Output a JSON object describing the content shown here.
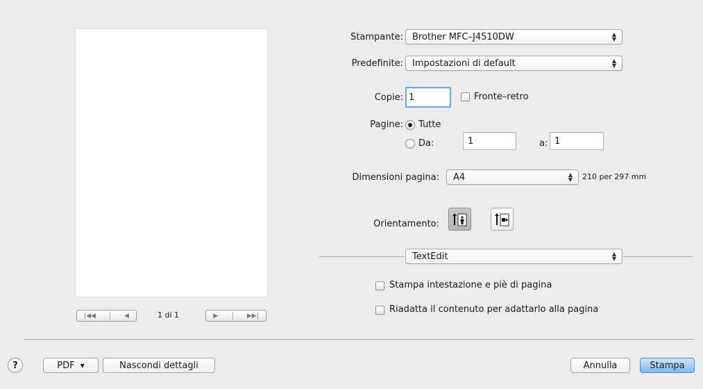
{
  "preview": {
    "page_counter": "1 di 1",
    "first_icon": "|◀◀",
    "prev_icon": "◀",
    "next_icon": "▶",
    "last_icon": "▶▶|"
  },
  "printer": {
    "label": "Stampante:",
    "value": "Brother MFC–J4510DW"
  },
  "presets": {
    "label": "Predefinite:",
    "value": "Impostazioni di default"
  },
  "copies": {
    "label": "Copie:",
    "value": "1",
    "duplex_label": "Fronte–retro",
    "duplex_checked": false
  },
  "pages": {
    "label": "Pagine:",
    "all_label": "Tutte",
    "all_selected": true,
    "range_label": "Da:",
    "from_value": "1",
    "to_label": "a:",
    "to_value": "1"
  },
  "paper_size": {
    "label": "Dimensioni pagina:",
    "value": "A4",
    "dimensions": "210 per 297 mm"
  },
  "orientation": {
    "label": "Orientamento:",
    "selected": "portrait"
  },
  "app_section": {
    "value": "TextEdit",
    "options": [
      {
        "label": "Stampa intestazione e piè di pagina",
        "checked": false
      },
      {
        "label": "Riadatta il contenuto per adattarlo alla pagina",
        "checked": false
      }
    ]
  },
  "footer": {
    "help_label": "?",
    "pdf_label": "PDF",
    "hide_details_label": "Nascondi dettagli",
    "cancel_label": "Annulla",
    "print_label": "Stampa"
  },
  "colors": {
    "accent": "#6aa6e8",
    "default_button": "#7fb7f0",
    "background": "#ececec"
  }
}
